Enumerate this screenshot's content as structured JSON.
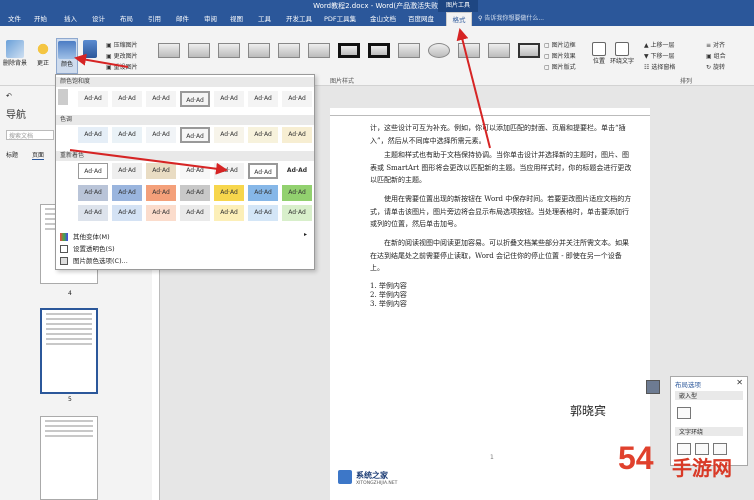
{
  "window": {
    "title": "Word教程2.docx - Word(产品激活失败)",
    "context_tab_group": "图片工具"
  },
  "tabs": [
    "文件",
    "开始",
    "插入",
    "设计",
    "布局",
    "引用",
    "邮件",
    "审阅",
    "视图",
    "工具",
    "开发工具",
    "PDF工具集",
    "金山文档",
    "百度网盘",
    "格式"
  ],
  "search_placeholder": "告诉我你想要做什么...",
  "ribbon": {
    "remove_bg": "删除背景",
    "corrections": "更正",
    "color": "颜色",
    "compress": "压缩图片",
    "change": "更改图片",
    "reset": "重设图片",
    "group_styles": "图片样式",
    "border": "图片边框",
    "effects": "图片效果",
    "layout": "图片版式",
    "position": "位置",
    "wrap_text": "环绕文字",
    "bring_forward": "上移一层",
    "send_backward": "下移一层",
    "selection_pane": "选择窗格",
    "align": "对齐",
    "group": "组合",
    "rotate": "旋转",
    "group_arrange": "排列"
  },
  "nav": {
    "title": "导航",
    "search_placeholder": "搜索文档",
    "tabs": [
      "标题",
      "页面"
    ],
    "page_numbers": [
      "4",
      "5"
    ]
  },
  "popup": {
    "sec_saturation": "颜色饱和度",
    "sec_tone": "色调",
    "sec_recolor": "重新着色",
    "swatch_label": "Ad·Ad",
    "more_variations": "其他变体(M)",
    "set_transparent": "设置透明色(S)",
    "color_options": "图片颜色选项(C)..."
  },
  "document": {
    "paragraphs": [
      "计，这些设计可互为补充。例如，你可以添加匹配的封面、页眉和提要栏。单击“插入”，然后从不同库中选择所需元素。",
      "主题和样式也有助于文档保持协调。当你单击设计并选择新的主题时，图片、图表或 SmartArt 图形将会更改以匹配新的主题。当应用样式时，你的标题会进行更改以匹配新的主题。",
      "使用在需要位置出现的新按钮在 Word 中保存时间。若要更改图片适应文档的方式，请单击该图片，图片旁边将会显示布局选项按钮。当处理表格时，单击要添加行或列的位置，然后单击加号。",
      "在新的阅读视图中阅读更加容易。可以折叠文档某些部分并关注所需文本。如果在达到结尾处之前需要停止读取，Word 会记住你的停止位置 - 即使在另一个设备上。"
    ],
    "list": [
      "1. 举例内容",
      "2. 举例内容",
      "3. 举例内容"
    ],
    "signature": "郭晓宾",
    "page_number": "1"
  },
  "layout_pane": {
    "title": "布局选项",
    "inline": "嵌入型",
    "wrap": "文字环绕"
  },
  "watermarks": {
    "site1": "系统之家",
    "site1_url": "XITONGZHIJIA.NET",
    "site2": "手游网"
  },
  "colors": {
    "brand_blue": "#2b579a",
    "arrow_red": "#d62424"
  }
}
